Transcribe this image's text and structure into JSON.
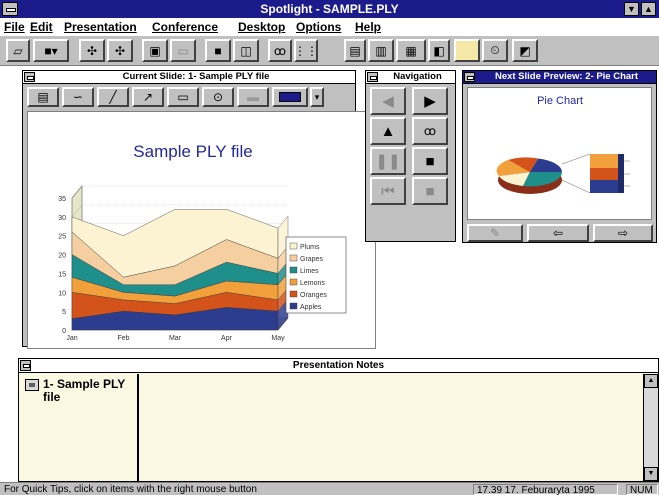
{
  "window": {
    "title": "Spotlight - SAMPLE.PLY"
  },
  "menu": [
    "File",
    "Edit",
    "Presentation",
    "Conference",
    "Desktop",
    "Options",
    "Help"
  ],
  "current_slide": {
    "caption": "Current Slide: 1- Sample PLY file",
    "slide_title": "Sample PLY file",
    "chart_data": {
      "type": "area",
      "x": [
        "Jan",
        "Feb",
        "Mar",
        "Apr",
        "May"
      ],
      "y_ticks": [
        "0",
        "5",
        "10",
        "15",
        "20",
        "25",
        "30",
        "35"
      ],
      "ylim": [
        0,
        35
      ],
      "stacked": true,
      "series": [
        {
          "name": "Apples",
          "values": [
            3,
            5,
            4,
            6,
            5
          ]
        },
        {
          "name": "Oranges",
          "values": [
            7,
            3,
            3,
            4,
            3
          ]
        },
        {
          "name": "Lemons",
          "values": [
            4,
            2,
            2,
            3,
            4
          ]
        },
        {
          "name": "Limes",
          "values": [
            6,
            2,
            3,
            5,
            3
          ]
        },
        {
          "name": "Grapes",
          "values": [
            6,
            2,
            5,
            6,
            4
          ]
        },
        {
          "name": "Plums",
          "values": [
            4,
            11,
            15,
            8,
            8
          ]
        }
      ],
      "legend_order": [
        "Plums",
        "Grapes",
        "Limes",
        "Lemons",
        "Oranges",
        "Apples"
      ],
      "colors": {
        "Apples": "#2c3d8f",
        "Oranges": "#d4531b",
        "Lemons": "#f2a03c",
        "Limes": "#1f8f8c",
        "Grapes": "#f6cfa0",
        "Plums": "#fbf3d2"
      }
    }
  },
  "navigation": {
    "caption": "Navigation"
  },
  "preview": {
    "caption": "Next Slide Preview: 2- Pie Chart",
    "slide_title": "Pie Chart"
  },
  "notes": {
    "caption": "Presentation Notes",
    "slide_item": "1- Sample PLY file"
  },
  "status": {
    "tip": "For Quick Tips, click on items with the right mouse button",
    "datetime": "17.39 17. Feburaryta 1995",
    "mode": "NUM"
  }
}
